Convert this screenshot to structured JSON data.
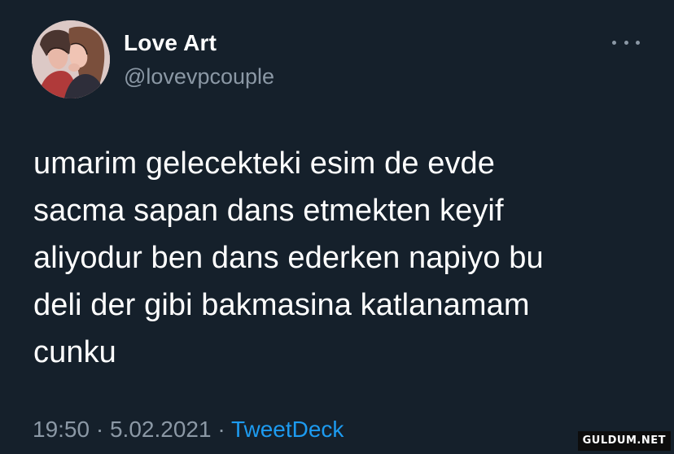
{
  "tweet": {
    "display_name": "Love Art",
    "handle": "@lovevpcouple",
    "text": "umarim gelecekteki esim de evde\nsacma sapan dans etmekten keyif\naliyodur ben dans ederken napiyo bu\ndeli der gibi bakmasina katlanamam\ncunku",
    "time": "19:50",
    "separator": " · ",
    "date": "5.02.2021",
    "source": "TweetDeck",
    "avatar_icon": "couple-kiss-illustration",
    "more_icon": "more-dots-icon"
  },
  "watermark": "GULDUM.NET",
  "colors": {
    "background": "#15202b",
    "text": "#ffffff",
    "secondary": "#8b98a5",
    "accent": "#1d9bf0"
  }
}
